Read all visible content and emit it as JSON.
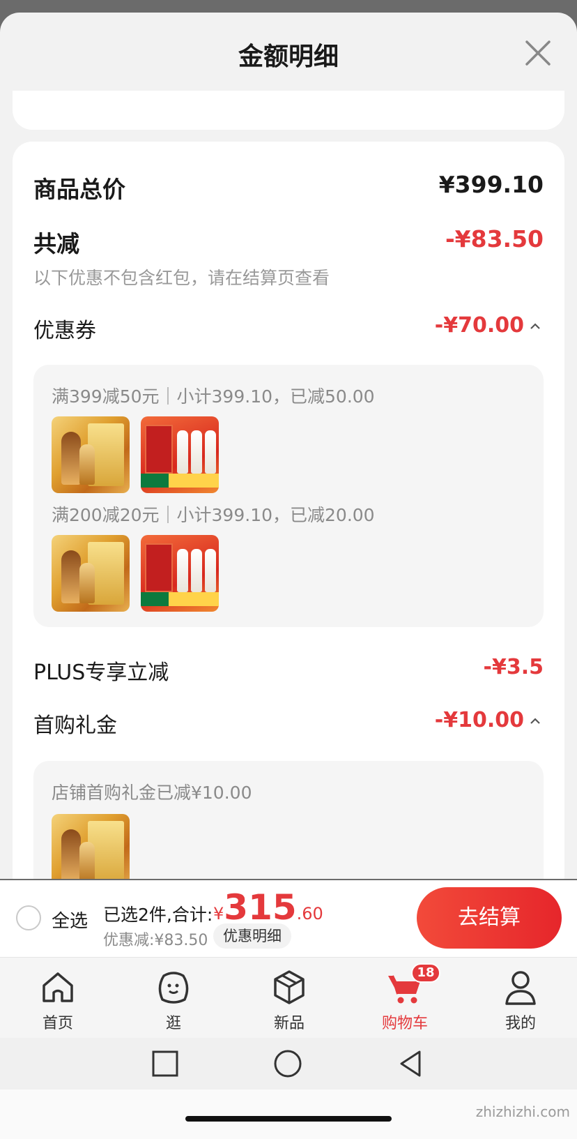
{
  "sheet": {
    "title": "金额明细"
  },
  "summary": {
    "goods_total_label": "商品总价",
    "goods_total_value": "¥399.10",
    "reduce_label": "共减",
    "reduce_value": "-¥83.50",
    "note": "以下优惠不包含红包，请在结算页查看"
  },
  "coupon": {
    "label": "优惠券",
    "value": "-¥70.00",
    "rules": [
      "满399减50元｜小计399.10，已减50.00",
      "满200减20元｜小计399.10，已减20.00"
    ]
  },
  "plus": {
    "label": "PLUS专享立减",
    "value": "-¥3.5"
  },
  "first_gift": {
    "label": "首购礼金",
    "value": "-¥10.00",
    "rule": "店铺首购礼金已减¥10.00"
  },
  "bottom_bar": {
    "select_all": "全选",
    "selected_count": "已选2件,合计:",
    "total_yen": "¥",
    "total_int": "315",
    "total_dec": ".60",
    "discount": "优惠减:¥83.50",
    "detail_button": "优惠明细",
    "checkout_button": "去结算"
  },
  "tabs": [
    {
      "label": "首页",
      "icon": "home-icon"
    },
    {
      "label": "逛",
      "icon": "browse-icon"
    },
    {
      "label": "新品",
      "icon": "new-products-icon"
    },
    {
      "label": "购物车",
      "icon": "cart-icon",
      "badge": "18",
      "active": true
    },
    {
      "label": "我的",
      "icon": "profile-icon"
    }
  ],
  "colors": {
    "accent_red": "#e4393c",
    "text_gray": "#8a8a8a"
  },
  "watermark": "zhizhizhi.com"
}
